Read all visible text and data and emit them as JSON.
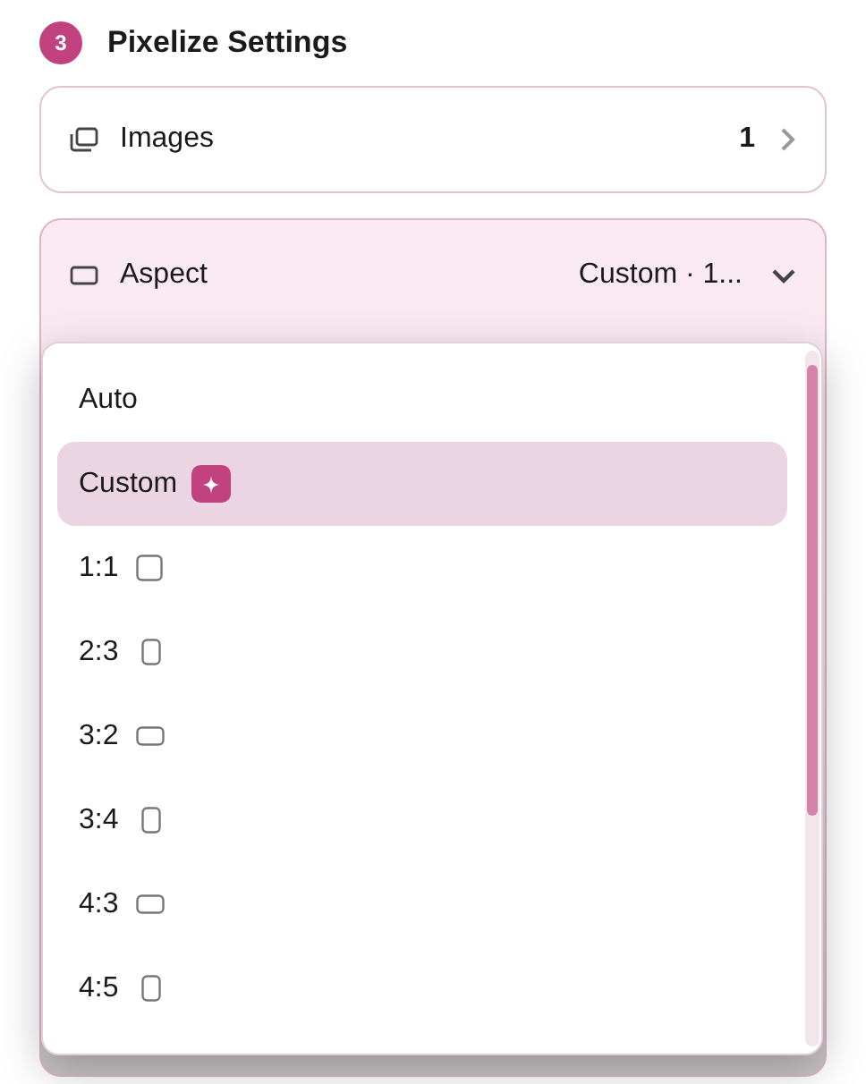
{
  "section": {
    "step": "3",
    "title": "Pixelize Settings"
  },
  "images_row": {
    "label": "Images",
    "count": "1"
  },
  "aspect_row": {
    "label": "Aspect",
    "value": "Custom · 1...",
    "expanded": true
  },
  "menu": {
    "items": [
      {
        "label": "Auto",
        "kind": "plain",
        "selected": false
      },
      {
        "label": "Custom",
        "kind": "custom",
        "selected": true
      },
      {
        "label": "1:1",
        "kind": "square",
        "selected": false
      },
      {
        "label": "2:3",
        "kind": "portrait",
        "selected": false
      },
      {
        "label": "3:2",
        "kind": "landscape",
        "selected": false
      },
      {
        "label": "3:4",
        "kind": "portrait",
        "selected": false
      },
      {
        "label": "4:3",
        "kind": "landscape",
        "selected": false
      },
      {
        "label": "4:5",
        "kind": "portrait",
        "selected": false
      }
    ]
  }
}
